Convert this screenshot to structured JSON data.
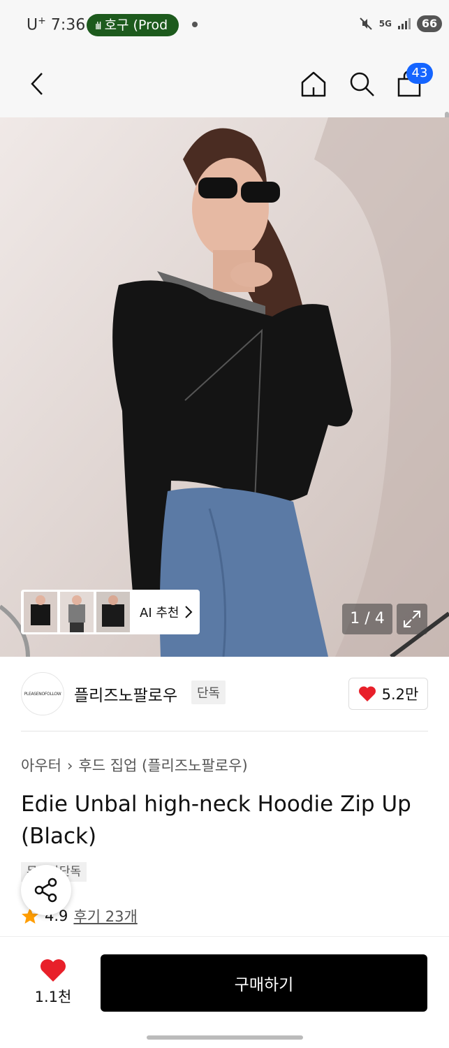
{
  "status_bar": {
    "carrier": "U",
    "carrier_sup": "+",
    "time": "7:36",
    "call_label": "호구 (Prod",
    "network": "5G",
    "battery": "66"
  },
  "nav": {
    "cart_count": "43"
  },
  "gallery": {
    "ai_label": "AI 추천",
    "counter": "1 / 4"
  },
  "brand": {
    "logo_text": "PLEASENOFOLLOW",
    "name": "플리즈노팔로우",
    "tag": "단독",
    "likes": "5.2만"
  },
  "product": {
    "breadcrumb": [
      "아우터",
      "후드 집업 (플리즈노팔로우)"
    ],
    "title": "Edie Unbal high-neck Hoodie Zip Up (Black)",
    "badge": "무신사단독",
    "rating": "4.9",
    "reviews": "후기 23개"
  },
  "bottom_bar": {
    "wish_count": "1.1천",
    "buy_label": "구매하기"
  },
  "colors": {
    "accent_blue": "#1565ff",
    "heart_red": "#e8202a",
    "star_orange": "#ff9d00",
    "call_green": "#1d5a1d"
  }
}
